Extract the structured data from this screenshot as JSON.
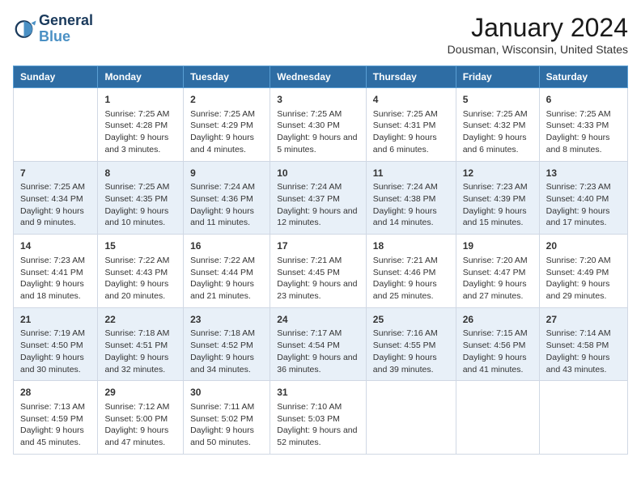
{
  "logo": {
    "line1": "General",
    "line2": "Blue"
  },
  "title": "January 2024",
  "location": "Dousman, Wisconsin, United States",
  "headers": [
    "Sunday",
    "Monday",
    "Tuesday",
    "Wednesday",
    "Thursday",
    "Friday",
    "Saturday"
  ],
  "weeks": [
    [
      {
        "day": "",
        "sunrise": "",
        "sunset": "",
        "daylight": ""
      },
      {
        "day": "1",
        "sunrise": "Sunrise: 7:25 AM",
        "sunset": "Sunset: 4:28 PM",
        "daylight": "Daylight: 9 hours and 3 minutes."
      },
      {
        "day": "2",
        "sunrise": "Sunrise: 7:25 AM",
        "sunset": "Sunset: 4:29 PM",
        "daylight": "Daylight: 9 hours and 4 minutes."
      },
      {
        "day": "3",
        "sunrise": "Sunrise: 7:25 AM",
        "sunset": "Sunset: 4:30 PM",
        "daylight": "Daylight: 9 hours and 5 minutes."
      },
      {
        "day": "4",
        "sunrise": "Sunrise: 7:25 AM",
        "sunset": "Sunset: 4:31 PM",
        "daylight": "Daylight: 9 hours and 6 minutes."
      },
      {
        "day": "5",
        "sunrise": "Sunrise: 7:25 AM",
        "sunset": "Sunset: 4:32 PM",
        "daylight": "Daylight: 9 hours and 6 minutes."
      },
      {
        "day": "6",
        "sunrise": "Sunrise: 7:25 AM",
        "sunset": "Sunset: 4:33 PM",
        "daylight": "Daylight: 9 hours and 8 minutes."
      }
    ],
    [
      {
        "day": "7",
        "sunrise": "Sunrise: 7:25 AM",
        "sunset": "Sunset: 4:34 PM",
        "daylight": "Daylight: 9 hours and 9 minutes."
      },
      {
        "day": "8",
        "sunrise": "Sunrise: 7:25 AM",
        "sunset": "Sunset: 4:35 PM",
        "daylight": "Daylight: 9 hours and 10 minutes."
      },
      {
        "day": "9",
        "sunrise": "Sunrise: 7:24 AM",
        "sunset": "Sunset: 4:36 PM",
        "daylight": "Daylight: 9 hours and 11 minutes."
      },
      {
        "day": "10",
        "sunrise": "Sunrise: 7:24 AM",
        "sunset": "Sunset: 4:37 PM",
        "daylight": "Daylight: 9 hours and 12 minutes."
      },
      {
        "day": "11",
        "sunrise": "Sunrise: 7:24 AM",
        "sunset": "Sunset: 4:38 PM",
        "daylight": "Daylight: 9 hours and 14 minutes."
      },
      {
        "day": "12",
        "sunrise": "Sunrise: 7:23 AM",
        "sunset": "Sunset: 4:39 PM",
        "daylight": "Daylight: 9 hours and 15 minutes."
      },
      {
        "day": "13",
        "sunrise": "Sunrise: 7:23 AM",
        "sunset": "Sunset: 4:40 PM",
        "daylight": "Daylight: 9 hours and 17 minutes."
      }
    ],
    [
      {
        "day": "14",
        "sunrise": "Sunrise: 7:23 AM",
        "sunset": "Sunset: 4:41 PM",
        "daylight": "Daylight: 9 hours and 18 minutes."
      },
      {
        "day": "15",
        "sunrise": "Sunrise: 7:22 AM",
        "sunset": "Sunset: 4:43 PM",
        "daylight": "Daylight: 9 hours and 20 minutes."
      },
      {
        "day": "16",
        "sunrise": "Sunrise: 7:22 AM",
        "sunset": "Sunset: 4:44 PM",
        "daylight": "Daylight: 9 hours and 21 minutes."
      },
      {
        "day": "17",
        "sunrise": "Sunrise: 7:21 AM",
        "sunset": "Sunset: 4:45 PM",
        "daylight": "Daylight: 9 hours and 23 minutes."
      },
      {
        "day": "18",
        "sunrise": "Sunrise: 7:21 AM",
        "sunset": "Sunset: 4:46 PM",
        "daylight": "Daylight: 9 hours and 25 minutes."
      },
      {
        "day": "19",
        "sunrise": "Sunrise: 7:20 AM",
        "sunset": "Sunset: 4:47 PM",
        "daylight": "Daylight: 9 hours and 27 minutes."
      },
      {
        "day": "20",
        "sunrise": "Sunrise: 7:20 AM",
        "sunset": "Sunset: 4:49 PM",
        "daylight": "Daylight: 9 hours and 29 minutes."
      }
    ],
    [
      {
        "day": "21",
        "sunrise": "Sunrise: 7:19 AM",
        "sunset": "Sunset: 4:50 PM",
        "daylight": "Daylight: 9 hours and 30 minutes."
      },
      {
        "day": "22",
        "sunrise": "Sunrise: 7:18 AM",
        "sunset": "Sunset: 4:51 PM",
        "daylight": "Daylight: 9 hours and 32 minutes."
      },
      {
        "day": "23",
        "sunrise": "Sunrise: 7:18 AM",
        "sunset": "Sunset: 4:52 PM",
        "daylight": "Daylight: 9 hours and 34 minutes."
      },
      {
        "day": "24",
        "sunrise": "Sunrise: 7:17 AM",
        "sunset": "Sunset: 4:54 PM",
        "daylight": "Daylight: 9 hours and 36 minutes."
      },
      {
        "day": "25",
        "sunrise": "Sunrise: 7:16 AM",
        "sunset": "Sunset: 4:55 PM",
        "daylight": "Daylight: 9 hours and 39 minutes."
      },
      {
        "day": "26",
        "sunrise": "Sunrise: 7:15 AM",
        "sunset": "Sunset: 4:56 PM",
        "daylight": "Daylight: 9 hours and 41 minutes."
      },
      {
        "day": "27",
        "sunrise": "Sunrise: 7:14 AM",
        "sunset": "Sunset: 4:58 PM",
        "daylight": "Daylight: 9 hours and 43 minutes."
      }
    ],
    [
      {
        "day": "28",
        "sunrise": "Sunrise: 7:13 AM",
        "sunset": "Sunset: 4:59 PM",
        "daylight": "Daylight: 9 hours and 45 minutes."
      },
      {
        "day": "29",
        "sunrise": "Sunrise: 7:12 AM",
        "sunset": "Sunset: 5:00 PM",
        "daylight": "Daylight: 9 hours and 47 minutes."
      },
      {
        "day": "30",
        "sunrise": "Sunrise: 7:11 AM",
        "sunset": "Sunset: 5:02 PM",
        "daylight": "Daylight: 9 hours and 50 minutes."
      },
      {
        "day": "31",
        "sunrise": "Sunrise: 7:10 AM",
        "sunset": "Sunset: 5:03 PM",
        "daylight": "Daylight: 9 hours and 52 minutes."
      },
      {
        "day": "",
        "sunrise": "",
        "sunset": "",
        "daylight": ""
      },
      {
        "day": "",
        "sunrise": "",
        "sunset": "",
        "daylight": ""
      },
      {
        "day": "",
        "sunrise": "",
        "sunset": "",
        "daylight": ""
      }
    ]
  ]
}
